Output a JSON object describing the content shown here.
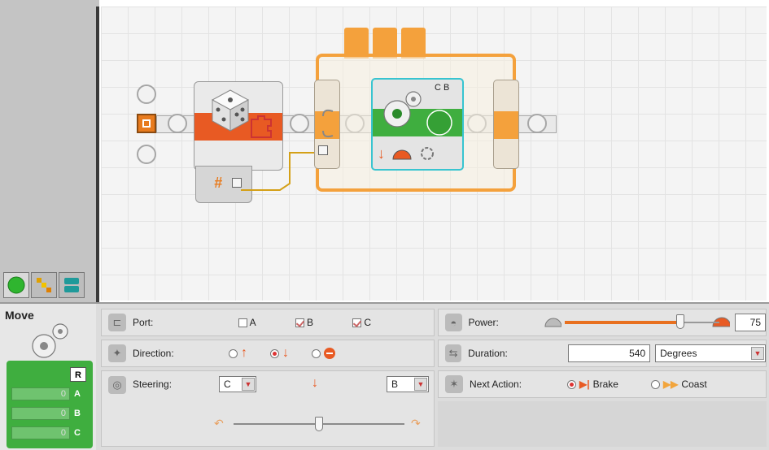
{
  "palette": {
    "tabs": [
      {
        "name": "common-palette",
        "color": "#2fb52f"
      },
      {
        "name": "complete-palette",
        "color": "#e0a000"
      },
      {
        "name": "custom-palette",
        "color": "#1f9a9a"
      }
    ]
  },
  "canvas": {
    "random_block": {
      "input_glyph": "#"
    },
    "move_block": {
      "ports_label": "C B"
    }
  },
  "config": {
    "block_name": "Move",
    "reset_label": "R",
    "port_values": [
      {
        "value": "0",
        "port": "A"
      },
      {
        "value": "0",
        "port": "B"
      },
      {
        "value": "0",
        "port": "C"
      }
    ],
    "port": {
      "label": "Port:",
      "options": [
        {
          "name": "A",
          "checked": false
        },
        {
          "name": "B",
          "checked": true
        },
        {
          "name": "C",
          "checked": true
        }
      ]
    },
    "direction": {
      "label": "Direction:",
      "options": [
        {
          "name": "forward",
          "selected": false
        },
        {
          "name": "backward",
          "selected": true
        },
        {
          "name": "stop",
          "selected": false
        }
      ]
    },
    "steering": {
      "label": "Steering:",
      "left_port": "C",
      "right_port": "B",
      "position": 0.5
    },
    "power": {
      "label": "Power:",
      "value": "75",
      "level": 0.75
    },
    "duration": {
      "label": "Duration:",
      "value": "540",
      "unit": "Degrees"
    },
    "next_action": {
      "label": "Next Action:",
      "brake_label": "Brake",
      "coast_label": "Coast",
      "selected": "Brake"
    }
  },
  "colors": {
    "accent_orange": "#f4a13c",
    "move_green": "#3fae3f",
    "random_red": "#e85a23",
    "wire": "#d4a017"
  }
}
